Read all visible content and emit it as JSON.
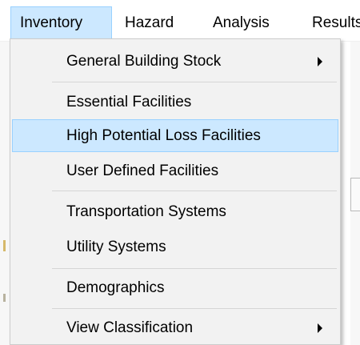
{
  "menubar": {
    "items": [
      {
        "label": "Inventory",
        "active": true
      },
      {
        "label": "Hazard"
      },
      {
        "label": "Analysis"
      },
      {
        "label": "Results"
      }
    ]
  },
  "dropdown": {
    "items": [
      {
        "label": "General Building Stock",
        "has_submenu": true
      },
      {
        "label": "Essential Facilities"
      },
      {
        "label": "High Potential Loss Facilities",
        "highlighted": true
      },
      {
        "label": "User Defined Facilities"
      },
      {
        "label": "Transportation Systems"
      },
      {
        "label": "Utility Systems"
      },
      {
        "label": "Demographics"
      },
      {
        "label": "View Classification",
        "has_submenu": true
      }
    ],
    "submenu_icon": "chevron-right-icon"
  },
  "colors": {
    "highlight_bg": "#cce8ff",
    "highlight_border": "#99d1ff",
    "menu_bg": "#f2f2f2"
  }
}
